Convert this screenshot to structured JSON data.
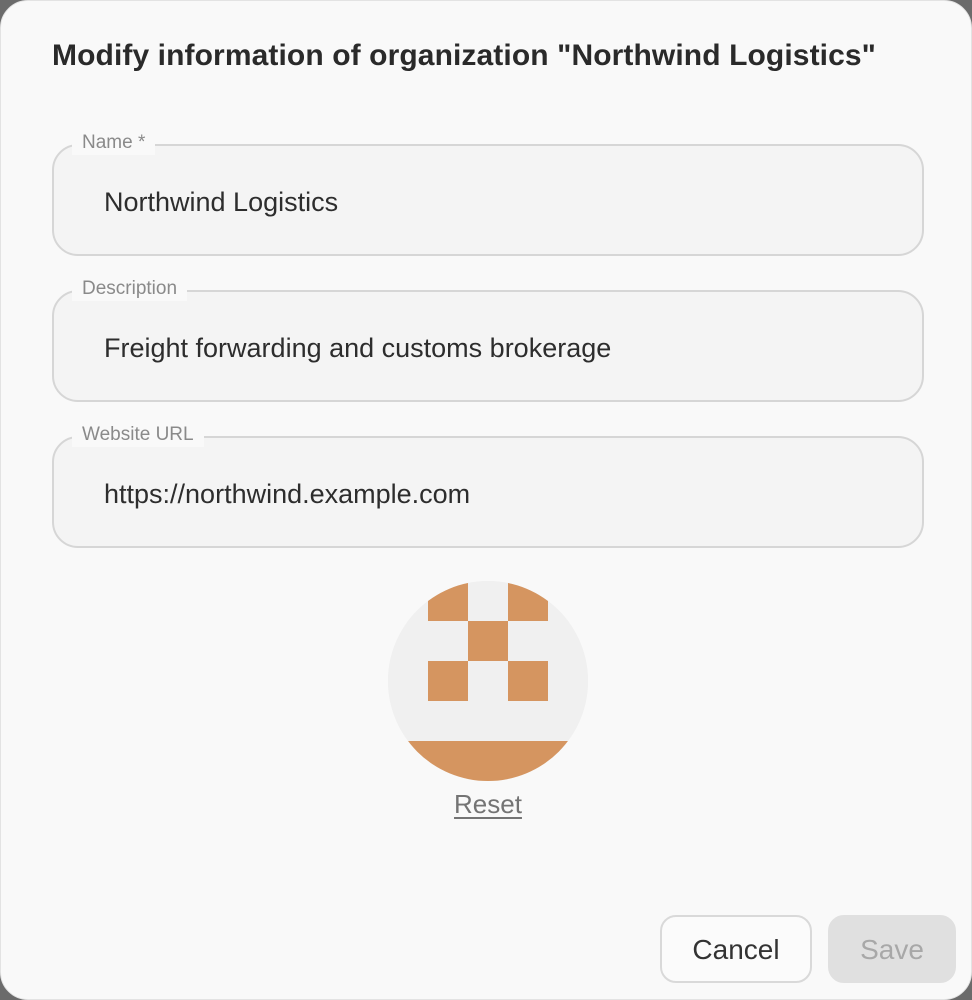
{
  "dialog": {
    "title": "Modify information of organization \"Northwind Logistics\""
  },
  "fields": {
    "name": {
      "label": "Name *",
      "value": "Northwind Logistics"
    },
    "description": {
      "label": "Description",
      "value": "Freight forwarding and customs brokerage"
    },
    "website": {
      "label": "Website URL",
      "value": "https://northwind.example.com"
    }
  },
  "avatar": {
    "icon": "identicon",
    "color": "#d59560",
    "background": "#f0f0f0",
    "reset_label": "Reset"
  },
  "actions": {
    "cancel_label": "Cancel",
    "save_label": "Save",
    "save_disabled": true
  }
}
